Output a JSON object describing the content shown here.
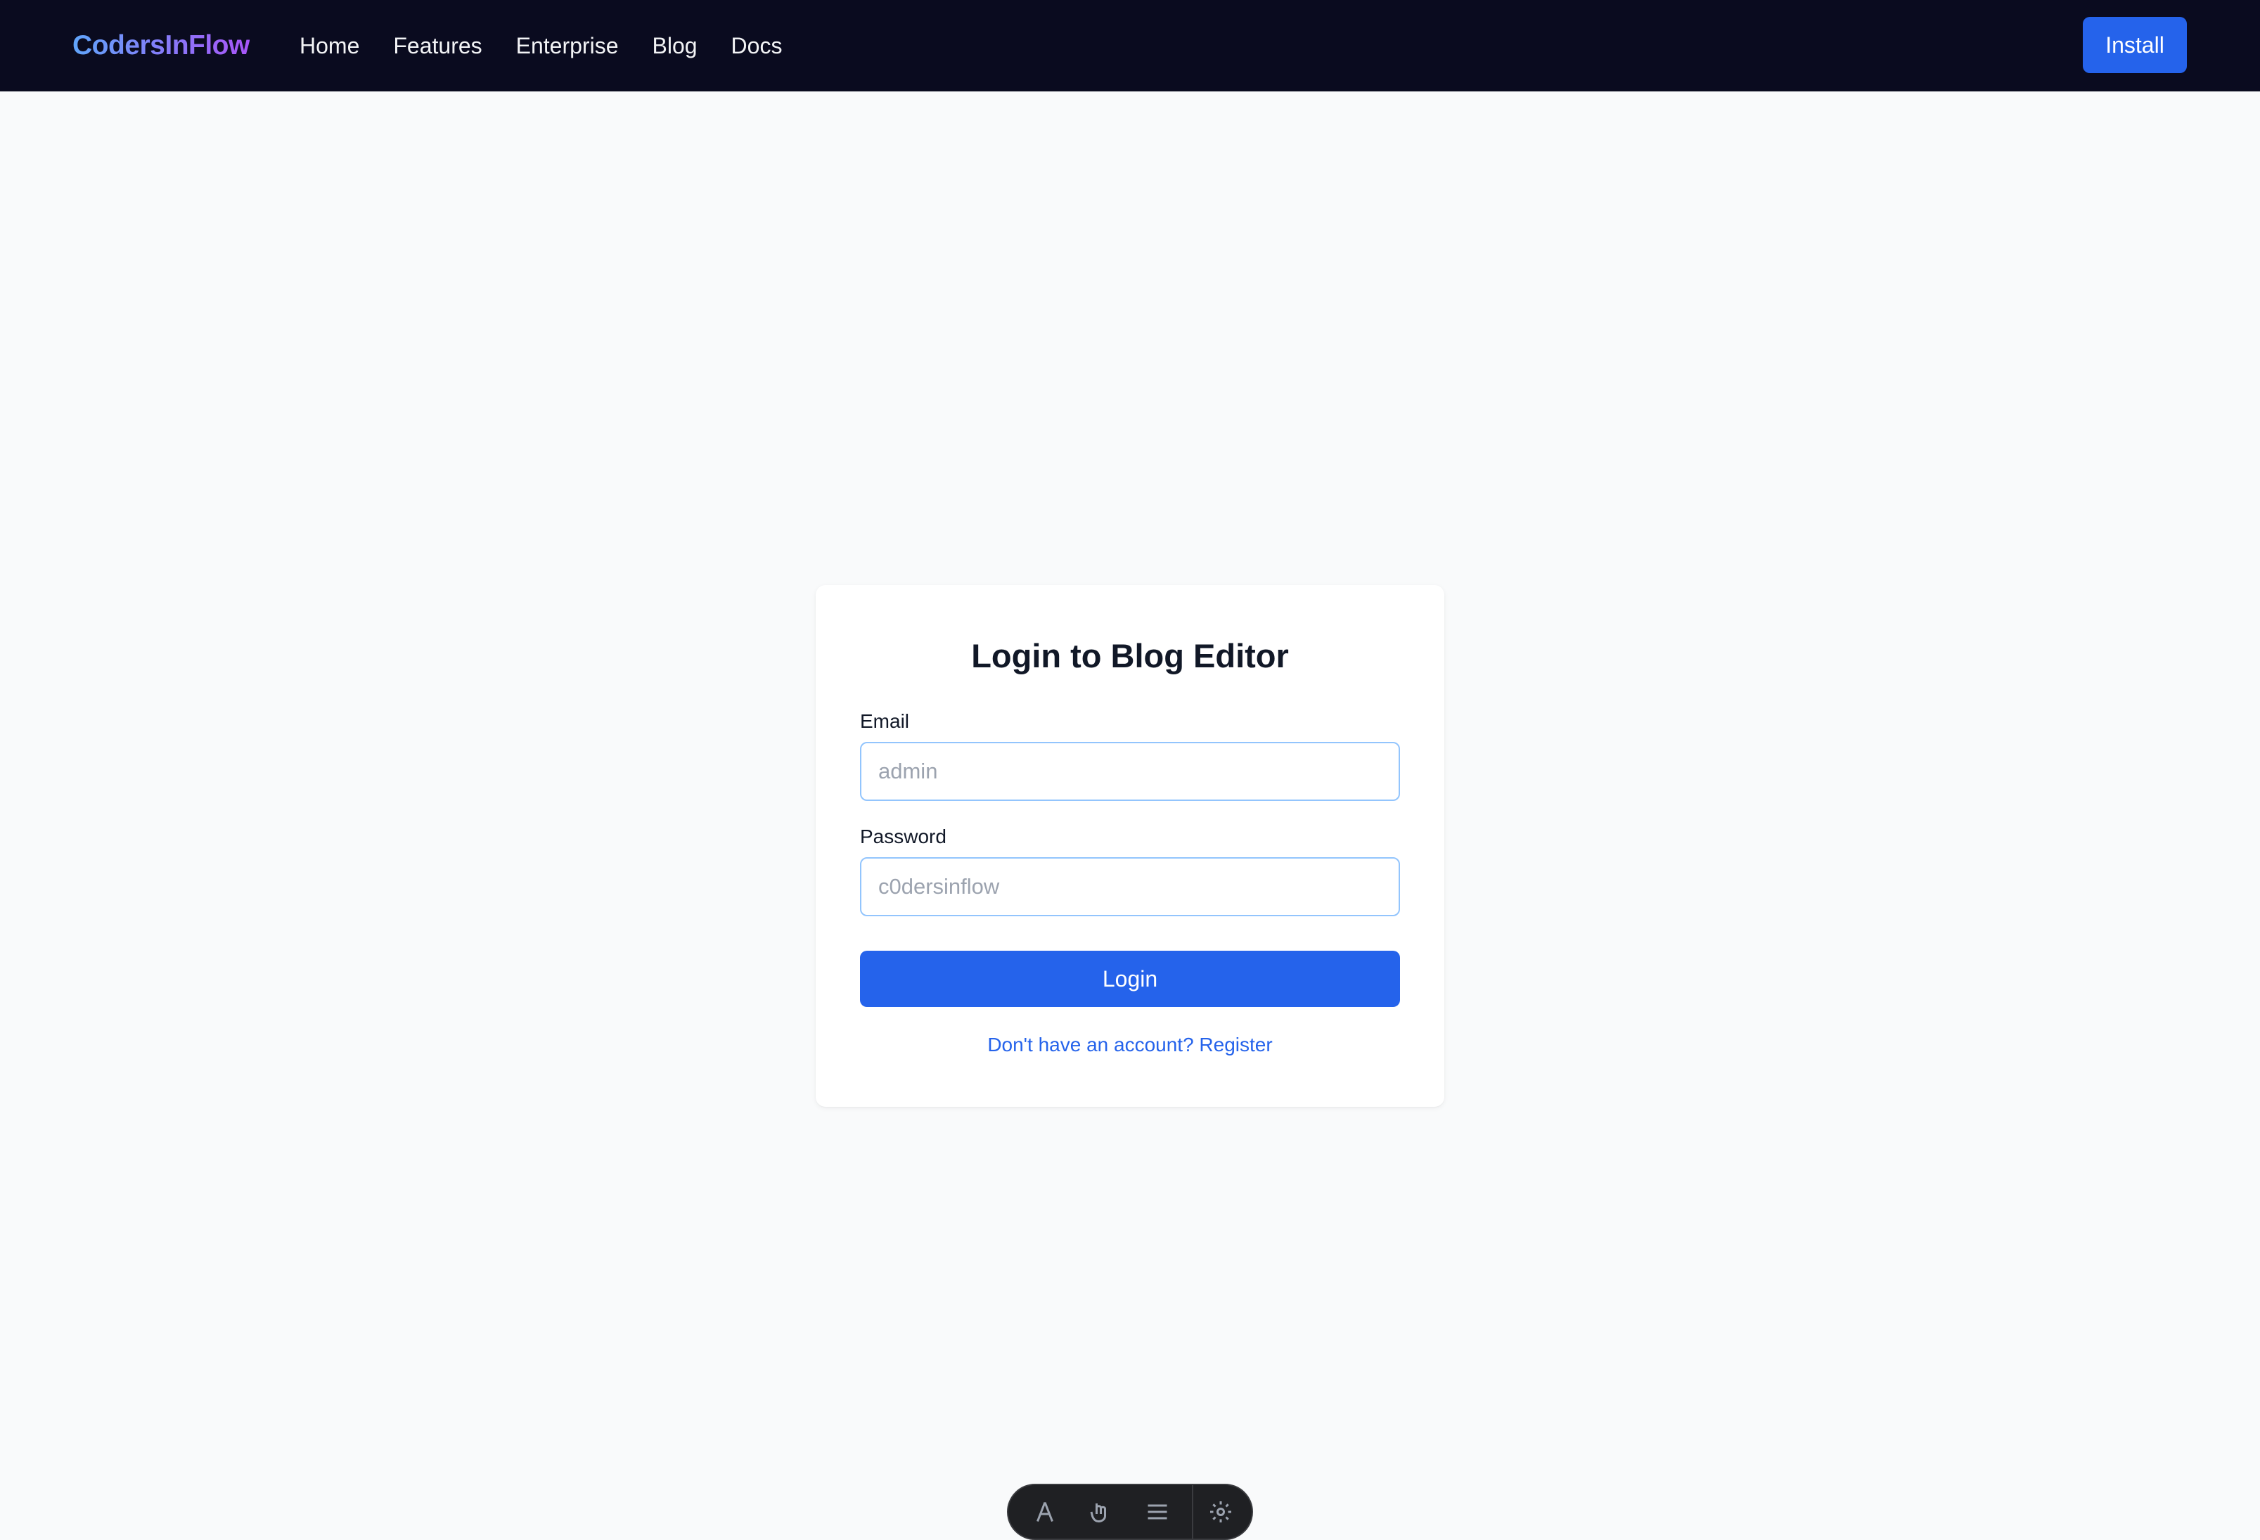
{
  "navbar": {
    "brand": "CodersInFlow",
    "links": [
      {
        "label": "Home"
      },
      {
        "label": "Features"
      },
      {
        "label": "Enterprise"
      },
      {
        "label": "Blog"
      },
      {
        "label": "Docs"
      }
    ],
    "install_label": "Install"
  },
  "login": {
    "title": "Login to Blog Editor",
    "email_label": "Email",
    "email_placeholder": "admin",
    "email_value": "",
    "password_label": "Password",
    "password_placeholder": "c0dersinflow",
    "password_value": "",
    "submit_label": "Login",
    "register_text": "Don't have an account? Register"
  },
  "dock": {
    "icons": [
      "cursor-icon",
      "pointer-icon",
      "menu-icon",
      "gear-icon"
    ]
  },
  "colors": {
    "navbar_bg": "#0a0b1f",
    "accent": "#2563eb",
    "page_bg": "#f9fafb",
    "input_border": "#93c5fd",
    "brand_gradient_start": "#60a5fa",
    "brand_gradient_end": "#a855f7"
  }
}
